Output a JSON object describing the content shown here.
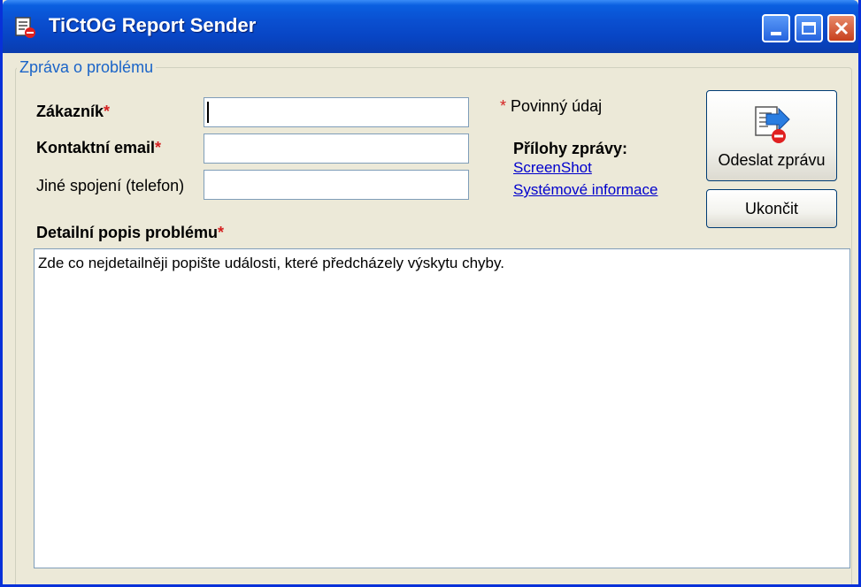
{
  "window": {
    "title": "TiCtOG Report Sender",
    "icons": {
      "app": "report-document-icon",
      "minimize": "minimize-icon",
      "maximize": "maximize-icon",
      "close": "close-icon"
    },
    "colors": {
      "titlebar": "#0a4fd0",
      "close_button": "#c7401d",
      "face": "#ece9d8"
    }
  },
  "form": {
    "group_title": "Zpráva o problému",
    "required_mark": "*",
    "fields": {
      "customer": {
        "label": "Zákazník",
        "value": ""
      },
      "email": {
        "label": "Kontaktní email",
        "value": ""
      },
      "phone": {
        "label": "Jiné spojení (telefon)",
        "value": ""
      }
    },
    "required_note": "Povinný údaj",
    "attachments": {
      "title": "Přílohy zprávy:",
      "links": [
        "ScreenShot",
        "Systémové informace"
      ]
    },
    "buttons": {
      "send": "Odeslat zprávu",
      "send_icon": "send-report-icon",
      "exit": "Ukončit"
    },
    "description": {
      "label": "Detailní popis problému",
      "value": "Zde co nejdetailněji popište události, které předcházely výskytu chyby."
    },
    "colors": {
      "required": "#d42020",
      "link": "#0000cc",
      "group_title": "#1a64c8"
    }
  }
}
